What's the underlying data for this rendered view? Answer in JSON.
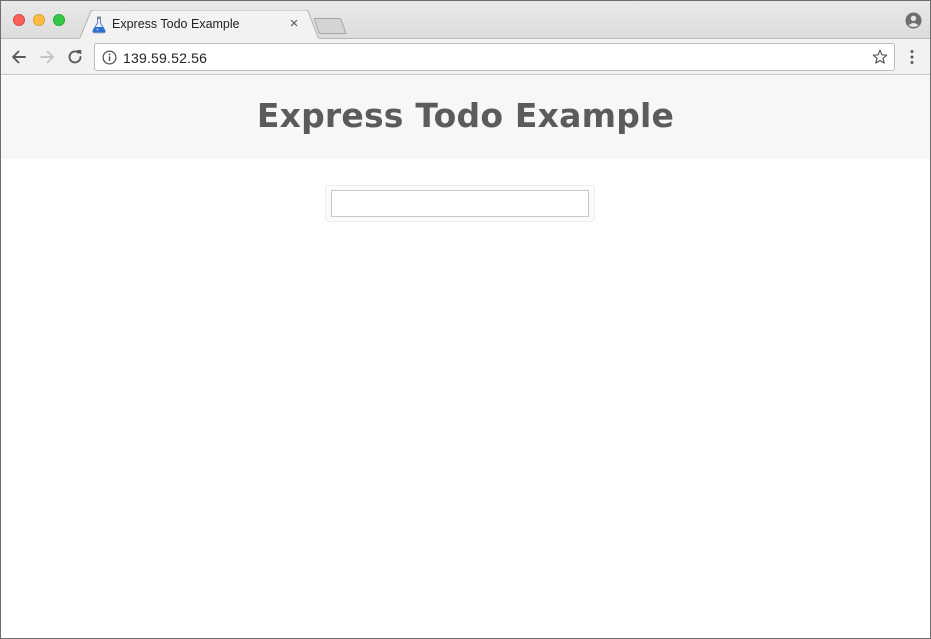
{
  "browser": {
    "tab": {
      "title": "Express Todo Example",
      "close_glyph": "×",
      "favicon": "flask-icon"
    },
    "address_bar": {
      "url": "139.59.52.56"
    },
    "icons": {
      "back": "arrow-left-icon",
      "forward": "arrow-right-icon",
      "reload": "reload-icon",
      "info": "info-icon",
      "bookmark": "star-icon",
      "menu": "kebab-menu-icon",
      "profile": "profile-icon"
    }
  },
  "page": {
    "title": "Express Todo Example",
    "todo_input": {
      "value": "",
      "placeholder": ""
    }
  },
  "colors": {
    "header_bg": "#f7f7f7",
    "title_text": "#5b5b5b",
    "traffic_close": "#fc605b",
    "traffic_minimize": "#fdbc40",
    "traffic_maximize": "#34c84a"
  }
}
